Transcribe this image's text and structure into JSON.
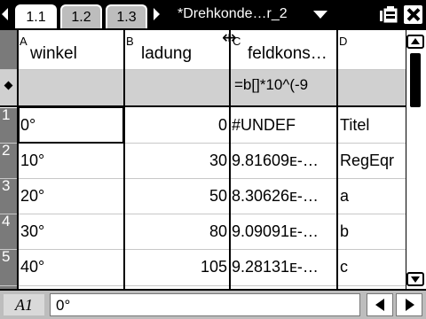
{
  "tabs": [
    {
      "label": "1.1",
      "active": true
    },
    {
      "label": "1.2",
      "active": false
    },
    {
      "label": "1.3",
      "active": false
    }
  ],
  "document": {
    "title": "*Drehkonde…r_2"
  },
  "icons": {
    "nav_left": "triangle-left-icon",
    "nav_right": "triangle-right-icon",
    "doc_menu": "triangle-down-icon",
    "battery": "battery-icon",
    "close": "close-icon",
    "resize": "column-resize-icon"
  },
  "columns": [
    {
      "letter": "A",
      "name": "winkel"
    },
    {
      "letter": "B",
      "name": "ladung"
    },
    {
      "letter": "C",
      "name": "feldkons…",
      "formula": "=b[]*10^(-9"
    },
    {
      "letter": "D",
      "name": "",
      "formula": ""
    }
  ],
  "rows": [
    {
      "num": "1",
      "a": "0°",
      "b": "0",
      "c": "#UNDEF",
      "d": "Titel"
    },
    {
      "num": "2",
      "a": "10°",
      "b": "30",
      "c": "9.81609ᴇ-…",
      "d": "RegEqr"
    },
    {
      "num": "3",
      "a": "20°",
      "b": "50",
      "c": "8.30626ᴇ-…",
      "d": "a"
    },
    {
      "num": "4",
      "a": "30°",
      "b": "80",
      "c": "9.09091ᴇ-…",
      "d": "b"
    },
    {
      "num": "5",
      "a": "40°",
      "b": "105",
      "c": "9.28131ᴇ-…",
      "d": "c"
    }
  ],
  "statusbar": {
    "cell_ref": "A1",
    "entry_value": "0°"
  }
}
